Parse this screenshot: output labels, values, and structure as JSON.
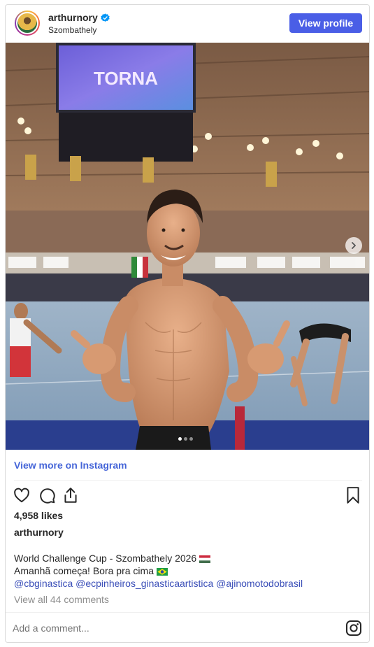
{
  "header": {
    "username": "arthurnory",
    "location": "Szombathely",
    "view_profile_label": "View profile",
    "verified_icon": "verified-badge-icon"
  },
  "photo": {
    "scoreboard_text": "TORNA",
    "dots_total": 3,
    "dots_active_index": 0
  },
  "view_more_label": "View more on Instagram",
  "actions": {
    "icons": [
      "heart-icon",
      "comment-icon",
      "share-icon",
      "bookmark-icon"
    ]
  },
  "likes_text": "4,958 likes",
  "author": "arthurnory",
  "caption": {
    "line1": "World Challenge Cup - Szombathely 2026",
    "line2": "Amanhã começa! Bora pra cima",
    "mentions": "@cbginastica @ecpinheiros_ginasticaartistica @ajinomotodobrasil"
  },
  "comments_link": "View all 44 comments",
  "comment_placeholder": "Add a comment...",
  "colors": {
    "accent": "#4a5ee6",
    "link": "#4565d8",
    "mention": "#3b4fb8",
    "muted": "#8e8e8e",
    "border": "#dbdbdb"
  }
}
